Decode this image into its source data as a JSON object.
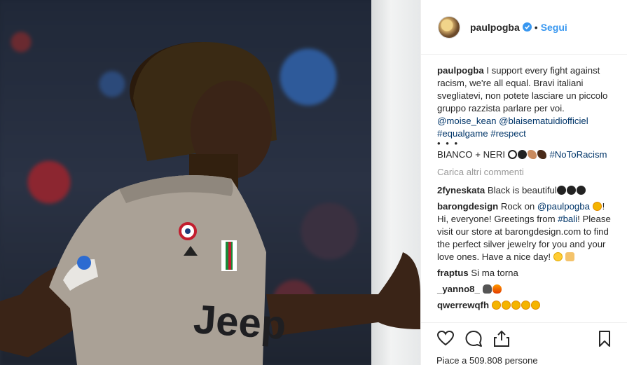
{
  "post": {
    "username": "paulpogba",
    "separator": "•",
    "follow_label": "Segui"
  },
  "caption": {
    "user": "paulpogba",
    "text": "I support every fight against racism, we're all equal. Bravi italiani svegliatevi, non potete lasciare un piccolo gruppo razzista parlare per voi.",
    "mention1": "@moise_kean",
    "mention2": "@blaisematuidiofficiel",
    "tag1": "#equalgame",
    "tag2": "#respect",
    "dots": "• • •",
    "line2_text": "BIANCO + NERI",
    "tag3": "#NoToRacism"
  },
  "load_more": "Carica altri commenti",
  "comments": [
    {
      "user": "2fyneskata",
      "text": "Black is beautiful"
    },
    {
      "user": "barongdesign",
      "text_pre": "Rock on",
      "mention": "@paulpogba",
      "text_mid": "! Hi, everyone! Greetings from",
      "tag": "#bali",
      "text_post": "! Please visit our store at barongdesign.com to find the perfect silver jewelry for you and your love ones. Have a nice day!"
    },
    {
      "user": "fraptus",
      "text": "Si ma torna"
    },
    {
      "user": "_yanno8_",
      "text": ""
    },
    {
      "user": "qwerrewqfh",
      "text": ""
    }
  ],
  "likes": "Piace a 509.808 persone",
  "icons": {
    "like": "heart-icon",
    "comment": "comment-icon",
    "share": "share-icon",
    "save": "bookmark-icon",
    "verified": "verified-badge-icon"
  },
  "colors": {
    "link": "#003569",
    "follow": "#3897f0",
    "muted": "#999999",
    "verified": "#3897f0"
  }
}
